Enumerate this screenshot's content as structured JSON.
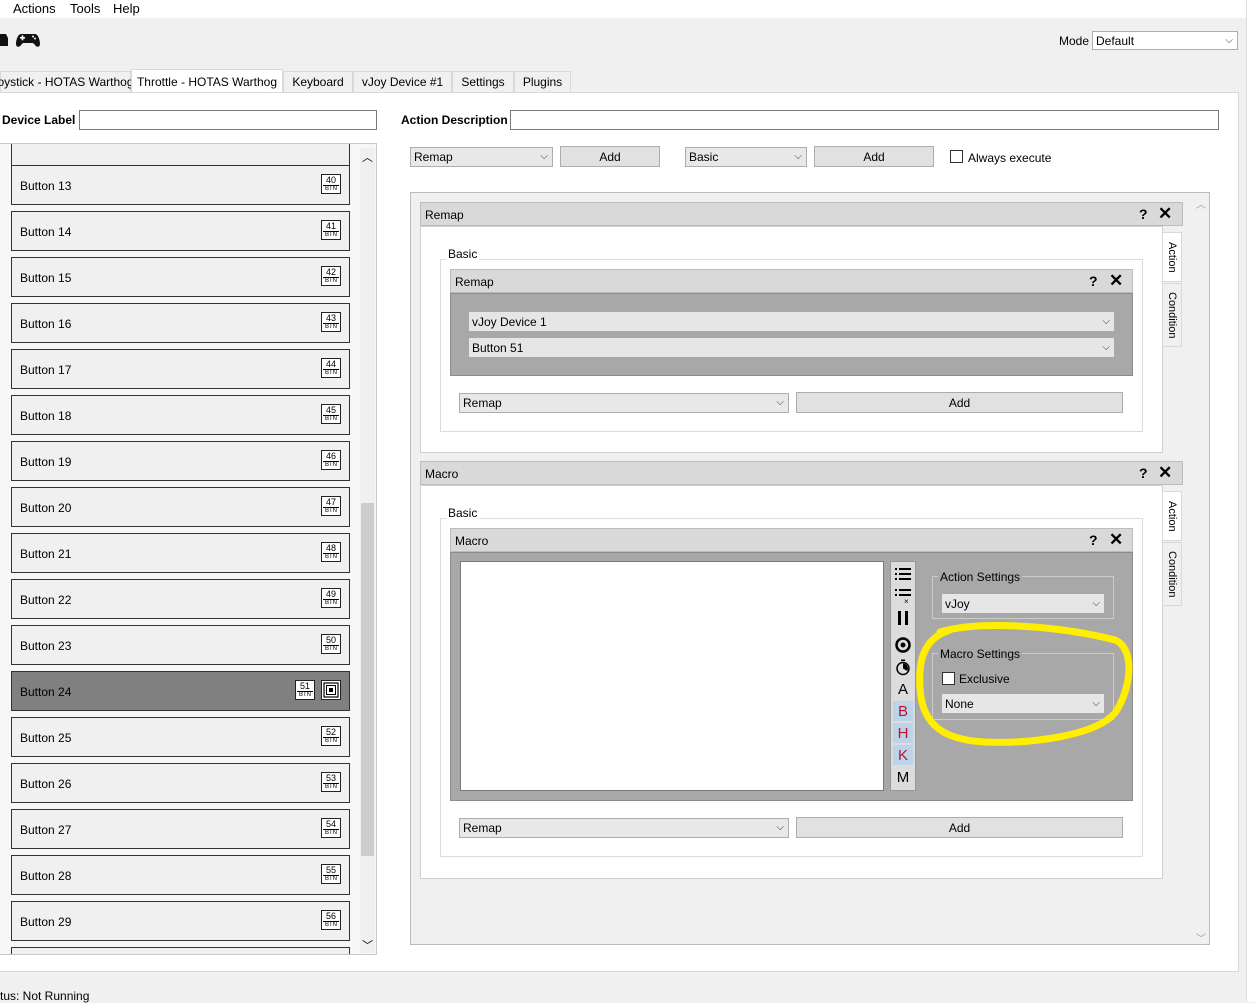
{
  "menubar": {
    "items": [
      "Actions",
      "Tools",
      "Help"
    ]
  },
  "toolbar": {
    "mode_label": "Mode",
    "mode_value": "Default"
  },
  "tabs": [
    "oystick - HOTAS Warthog",
    "Throttle - HOTAS Warthog",
    "Keyboard",
    "vJoy Device #1",
    "Settings",
    "Plugins"
  ],
  "device_label": "Device Label",
  "action_description": "Action Description",
  "add_bar": {
    "action_select": "Remap",
    "add_label": "Add",
    "container_select": "Basic",
    "always_execute": "Always execute"
  },
  "buttons_list": [
    {
      "label": "Button 13",
      "num": "40"
    },
    {
      "label": "Button 14",
      "num": "41"
    },
    {
      "label": "Button 15",
      "num": "42"
    },
    {
      "label": "Button 16",
      "num": "43"
    },
    {
      "label": "Button 17",
      "num": "44"
    },
    {
      "label": "Button 18",
      "num": "45"
    },
    {
      "label": "Button 19",
      "num": "46"
    },
    {
      "label": "Button 20",
      "num": "47"
    },
    {
      "label": "Button 21",
      "num": "48"
    },
    {
      "label": "Button 22",
      "num": "49"
    },
    {
      "label": "Button 23",
      "num": "50"
    },
    {
      "label": "Button 24",
      "num": "51"
    },
    {
      "label": "Button 25",
      "num": "52"
    },
    {
      "label": "Button 26",
      "num": "53"
    },
    {
      "label": "Button 27",
      "num": "54"
    },
    {
      "label": "Button 28",
      "num": "55"
    },
    {
      "label": "Button 29",
      "num": "56"
    }
  ],
  "btn_tag": "BTN",
  "remap_container": {
    "title": "Remap",
    "group": "Basic",
    "inner_title": "Remap",
    "device_select": "vJoy Device 1",
    "button_select": "Button 51",
    "bottom_select": "Remap",
    "add_label": "Add",
    "tab_action": "Action",
    "tab_condition": "Condition"
  },
  "macro_container": {
    "title": "Macro",
    "group": "Basic",
    "inner_title": "Macro",
    "action_settings_title": "Action Settings",
    "action_settings_value": "vJoy",
    "macro_settings_title": "Macro Settings",
    "exclusive_label": "Exclusive",
    "macro_settings_value": "None",
    "bottom_select": "Remap",
    "add_label": "Add",
    "tab_action": "Action",
    "tab_condition": "Condition",
    "tools": [
      "A",
      "B",
      "H",
      "K",
      "M"
    ]
  },
  "title_help": "?",
  "title_close": "✕",
  "status": "tus: Not Running",
  "colors": {
    "highlight": "#ffee00",
    "selected_row": "#808080",
    "tool_highlight": "#bcd4ea",
    "tool_red": "#c0102a"
  }
}
